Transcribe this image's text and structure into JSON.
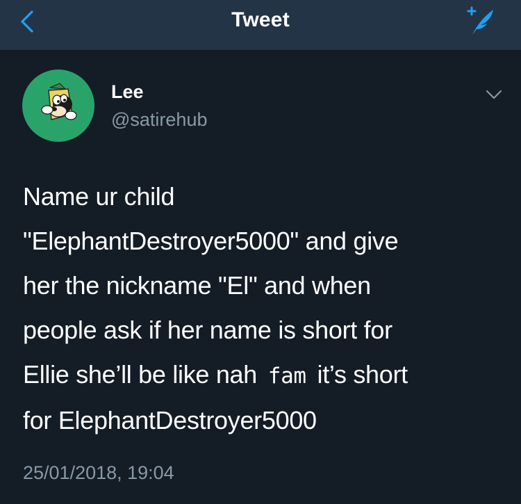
{
  "navbar": {
    "title": "Tweet",
    "back_icon": "chevron-left-icon",
    "compose_icon": "compose-quill-icon",
    "accent_color": "#1da1f2"
  },
  "tweet": {
    "author": {
      "display_name": "Lee",
      "handle": "@satirehub",
      "avatar_bg": "#2aa36b"
    },
    "text_lines": [
      "Name ur child",
      "\"ElephantDestroyer5000\" and give",
      "her the nickname \"El\" and when",
      "people ask if her name is short for"
    ],
    "line5": {
      "before": "Ellie she’ll be like nah",
      "mono": "fam",
      "after": "it’s short"
    },
    "last_line": "for ElephantDestroyer5000",
    "timestamp": "25/01/2018, 19:04",
    "menu_icon": "chevron-down-icon"
  },
  "colors": {
    "background": "#141d26",
    "navbar": "#243447",
    "text": "#ffffff",
    "muted": "#8899a6"
  }
}
